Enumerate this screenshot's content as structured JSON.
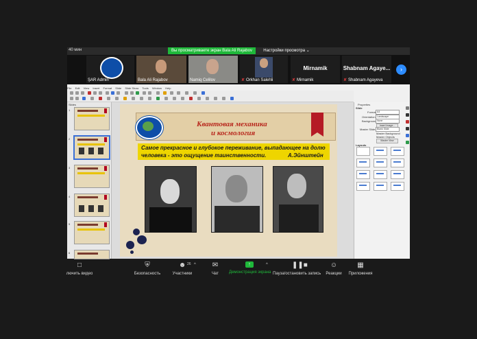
{
  "top_bar": {
    "timer": "40 мин",
    "share_banner": "Вы просматриваете экран Bala Ali Rajabov",
    "view_options": "Настройки просмотра"
  },
  "participants": [
    {
      "name": "ŞAR Admin",
      "muted": false
    },
    {
      "name": "Bala Ali Rajabov",
      "muted": false
    },
    {
      "name": "Namiq Celilov",
      "muted": false
    },
    {
      "name": "Orkhan Salehli",
      "muted": true
    },
    {
      "name": "Mirnamik",
      "muted": true,
      "display_name": "Mirnamik"
    },
    {
      "name": "Shabnam Agayeva",
      "muted": true,
      "display_name": "Shabnam  Agaye..."
    }
  ],
  "impress": {
    "menu": [
      "File",
      "Edit",
      "View",
      "Insert",
      "Format",
      "Slide",
      "Slide Show",
      "Tools",
      "Window",
      "Help"
    ],
    "slides_label": "Slides",
    "slide_numbers": [
      "1",
      "2",
      "3",
      "4",
      "5",
      "6"
    ],
    "slide": {
      "title_line1": "Квантовая механика",
      "title_line2": "и космология",
      "quote_line1": "Самое прекрасное и глубокое переживание, выпадающее на долю",
      "quote_line2": "человека - это ощущение таинственности.",
      "quote_author": "А.Эйнштейн"
    },
    "properties": {
      "header": "Properties",
      "section": "Slide",
      "format_label": "Format:",
      "format_value": "A4",
      "orientation_label": "Orientation:",
      "orientation_value": "Landscape",
      "background_label": "Background:",
      "background_value": "None",
      "insert_image": "Insert Image...",
      "master_slide_label": "Master Slide:",
      "master_slide_value": "Blank Slide",
      "master_background": "Master Background",
      "master_objects": "Master Objects",
      "master_view": "Master View",
      "layouts_label": "Layouts"
    }
  },
  "controls": [
    {
      "label": "лючить видео",
      "icon": "video-off-icon"
    },
    {
      "label": "Безопасность",
      "icon": "shield-icon"
    },
    {
      "label": "Участники",
      "icon": "participants-icon",
      "count": "26"
    },
    {
      "label": "Чат",
      "icon": "chat-icon"
    },
    {
      "label": "Демонстрация экрана",
      "icon": "share-screen-icon"
    },
    {
      "label": "Пауза/остановить запись",
      "icon": "record-icon"
    },
    {
      "label": "Реакции",
      "icon": "reaction-icon"
    },
    {
      "label": "Приложения",
      "icon": "apps-icon"
    }
  ],
  "colors": {
    "share_green": "#1fb83a",
    "accent_blue": "#2d8cff",
    "slide_bg": "#e9dcc0",
    "quote_yellow": "#eed500",
    "title_red": "#b8281d"
  }
}
